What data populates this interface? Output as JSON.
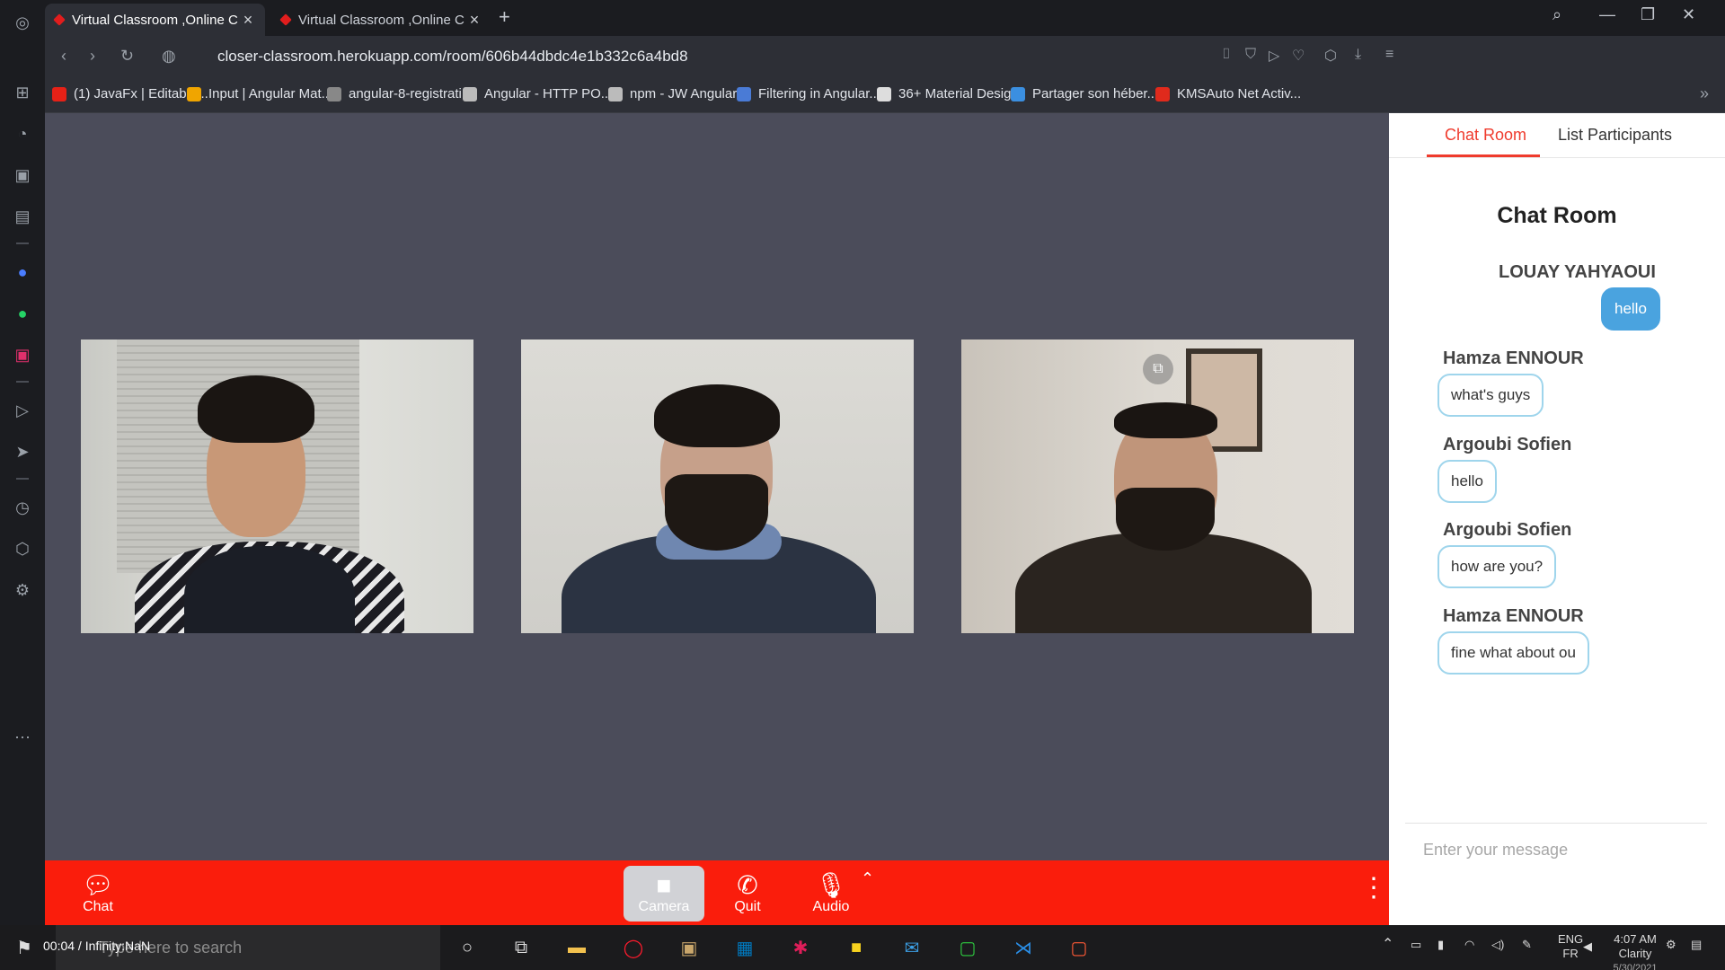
{
  "browser": {
    "tabs": [
      {
        "title": "Virtual Classroom ,Online C",
        "active": true
      },
      {
        "title": "Virtual Classroom ,Online C",
        "active": false
      }
    ],
    "url": "closer-classroom.herokuapp.com/room/606b44dbdc4e1b332c6a4bd8",
    "bookmarks": [
      {
        "label": "(1) JavaFx | Editable...",
        "color": "#e62117"
      },
      {
        "label": "Input | Angular Mat...",
        "color": "#f0a500"
      },
      {
        "label": "angular-8-registrati...",
        "color": "#888888"
      },
      {
        "label": "Angular - HTTP PO...",
        "color": "#bbbbbb"
      },
      {
        "label": "npm - JW Angular...",
        "color": "#bbbbbb"
      },
      {
        "label": "Filtering in Angular...",
        "color": "#4a7bd6"
      },
      {
        "label": "36+ Material Desig...",
        "color": "#dddddd"
      },
      {
        "label": "Partager son héber...",
        "color": "#3b8fe0"
      },
      {
        "label": "KMSAuto Net Activ...",
        "color": "#e02a1c"
      }
    ]
  },
  "controls": {
    "chat": "Chat",
    "camera": "Camera",
    "quit": "Quit",
    "audio": "Audio"
  },
  "panel": {
    "tabs": [
      "Chat Room",
      "List Participants"
    ],
    "title": "Chat Room",
    "messages": [
      {
        "sender": "LOUAY YAHYAOUI",
        "text": "hello",
        "mine": true
      },
      {
        "sender": "Hamza ENNOUR",
        "text": "what's guys",
        "mine": false
      },
      {
        "sender": "Argoubi Sofien",
        "text": "hello",
        "mine": false
      },
      {
        "sender": "Argoubi Sofien",
        "text": "how are you?",
        "mine": false
      },
      {
        "sender": "Hamza ENNOUR",
        "text": "fine what about ou",
        "mine": false
      }
    ],
    "input_placeholder": "Enter your message"
  },
  "taskbar": {
    "search_placeholder": "Type here to search",
    "timecode": "00:04 / Infinity:NaN",
    "lang": "ENG",
    "lang_sub": "FR",
    "time": "4:07 AM",
    "app_label": "Clarity",
    "date": "5/30/2021"
  },
  "colors": {
    "accent_red": "#fa1d0c",
    "tab_accent": "#ef3b2d",
    "my_bubble": "#4aa3df",
    "stage_bg": "#4b4c5a"
  }
}
